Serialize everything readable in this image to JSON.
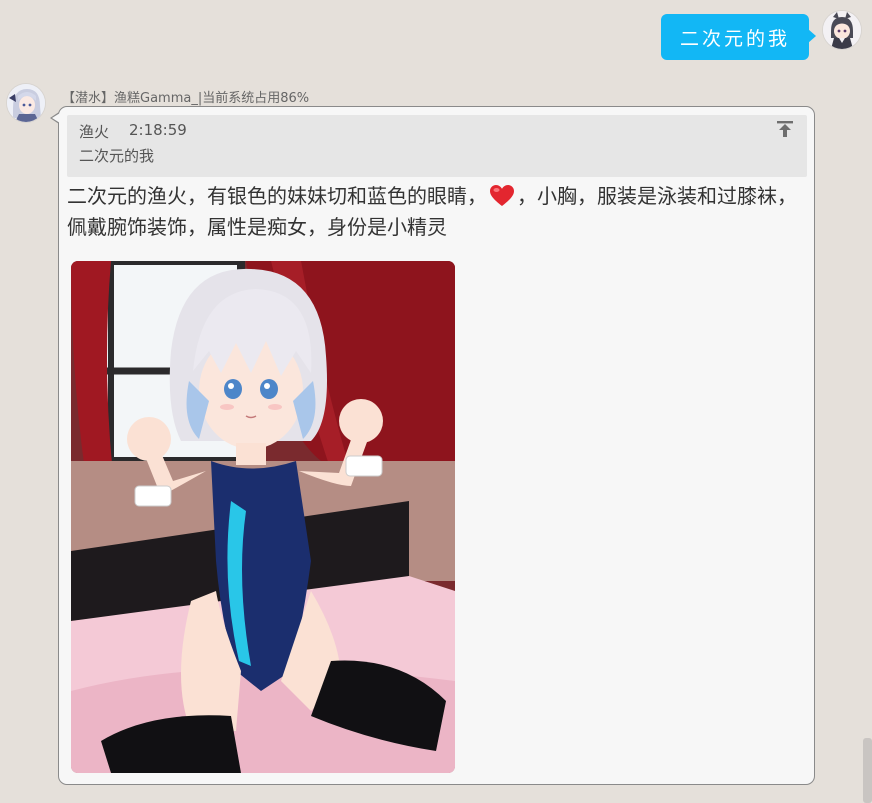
{
  "outgoing": {
    "text": "二次元的我",
    "avatar_icon": "anime-avatar-icon"
  },
  "incoming": {
    "sender": "【潜水】渔糕Gamma_|当前系统占用86%",
    "avatar_icon": "anime-avatar-icon",
    "quote": {
      "name": "渔火",
      "time": "2:18:59",
      "text": "二次元的我",
      "jump_icon": "arrow-to-top-icon"
    },
    "text_before_emoji": "二次元的渔火，有银色的妹妹切和蓝色的眼睛，",
    "emoji": "heart-icon",
    "text_after_emoji": "，小胸，服装是泳装和过膝袜，佩戴腕饰装饰，属性是痴女，身份是小精灵",
    "image_icon": "anime-illustration-image"
  },
  "colors": {
    "background": "#e5e0da",
    "outgoing_bubble": "#12b7f5",
    "incoming_bubble": "#f7f7f7",
    "quote_bg": "#e6e6e6",
    "heart": "#e3262f"
  }
}
